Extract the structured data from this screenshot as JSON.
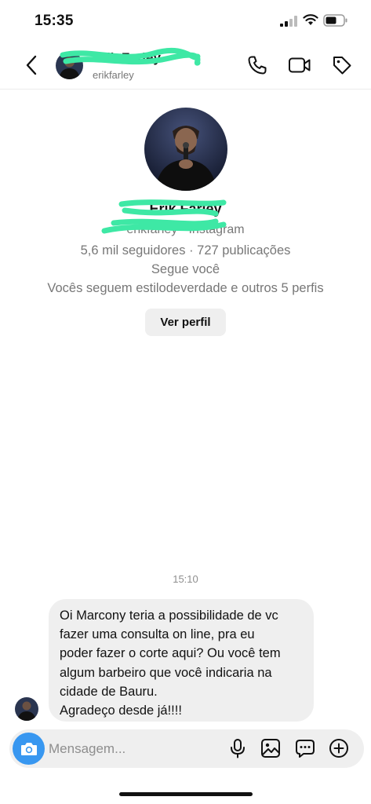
{
  "status_bar": {
    "time": "15:35",
    "icons": [
      "cellular-signal-icon",
      "wifi-icon",
      "battery-icon"
    ]
  },
  "header": {
    "name": "Erik Farley",
    "username": "erikfarley",
    "back_icon": "chevron-left-icon",
    "actions": [
      "phone-icon",
      "video-camera-icon",
      "tag-icon"
    ]
  },
  "profile": {
    "name": "Erik Farley",
    "subtitle": "erikfarley · Instagram",
    "stats": "5,6 mil seguidores · 727 publicações",
    "follows_you": "Segue você",
    "mutual": "Vocês seguem estilodeverdade e outros 5 perfis",
    "view_profile_label": "Ver perfil"
  },
  "messages": {
    "timestamp": "15:10",
    "items": [
      {
        "text": "Oi Marcony teria a possibilidade de vc\nfazer uma consulta on line, pra eu\npoder fazer o corte aqui? Ou você tem\nalgum barbeiro que você indicaria na\ncidade de Bauru.\nAgradeço desde já!!!!"
      }
    ]
  },
  "composer": {
    "placeholder": "Mensagem...",
    "icons": [
      "camera-icon",
      "microphone-icon",
      "image-icon",
      "sticker-chat-icon",
      "plus-circle-icon"
    ]
  },
  "colors": {
    "accent": "#3897f0",
    "bubble": "#efefef",
    "redaction": "#3ee8a5"
  }
}
